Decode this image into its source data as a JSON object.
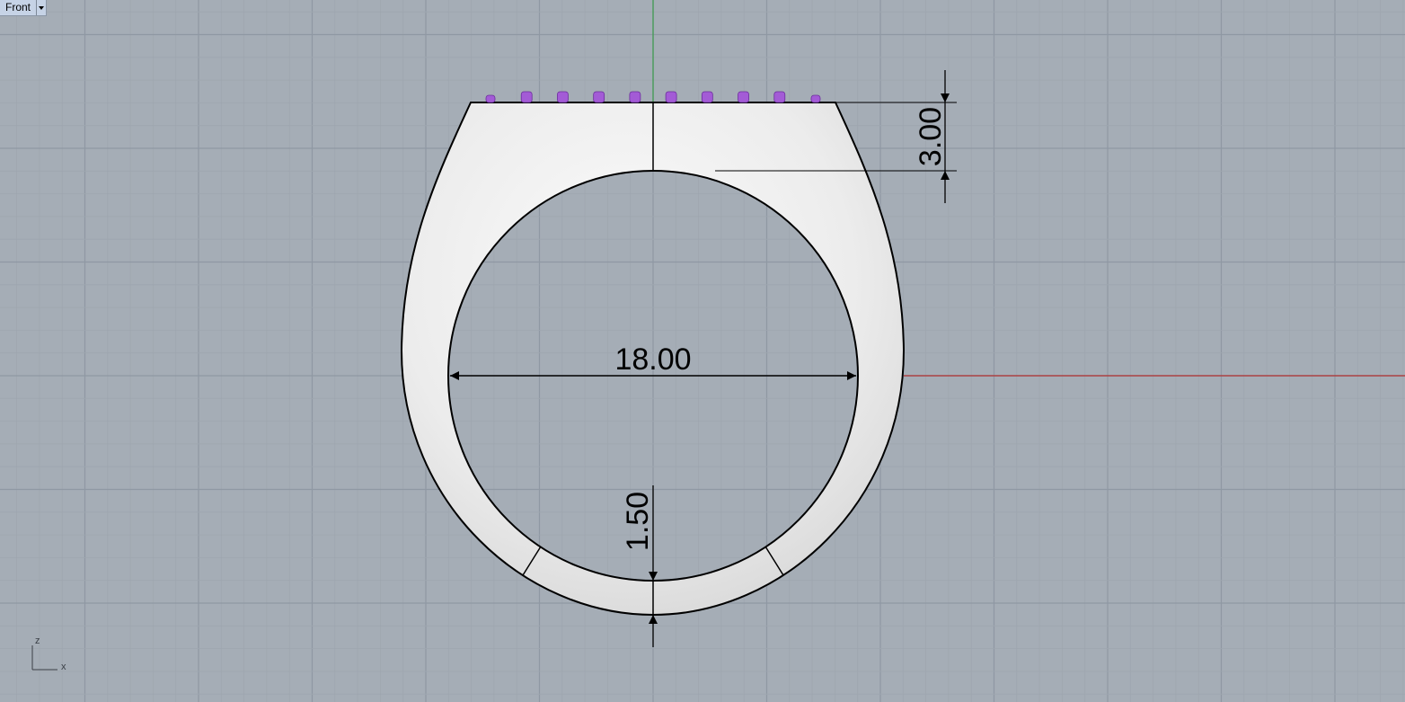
{
  "viewport": {
    "name": "Front",
    "background_color": "#a5adb6",
    "grid_minor_color": "#9ea6af",
    "grid_major_color": "#8f98a3",
    "x_axis_color": "#b03030",
    "z_axis_color": "#3a9a4a"
  },
  "model": {
    "object": "ring",
    "body_color": "#f2f2f2",
    "outline_color": "#000000",
    "gem_color": "#a35bd6",
    "gem_count": 10
  },
  "dimensions": {
    "inner_diameter": "18.00",
    "top_thickness": "3.00",
    "bottom_thickness": "1.50"
  },
  "axis_widget": {
    "vertical_label": "z",
    "horizontal_label": "x"
  }
}
